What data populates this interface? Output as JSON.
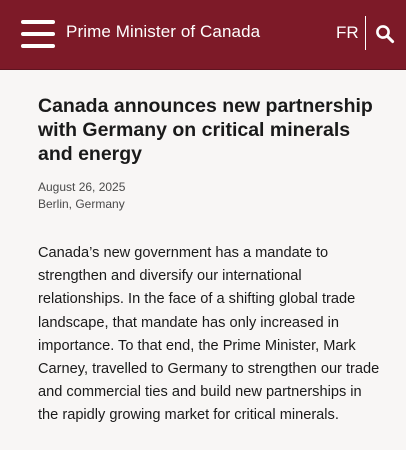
{
  "header": {
    "title": "Prime Minister of Canada",
    "lang_label": "FR",
    "menu_icon": "hamburger-menu-icon",
    "search_icon": "search-icon",
    "brand_color": "#7d1a28"
  },
  "article": {
    "title": "Canada announces new partnership with Germany on critical minerals and energy",
    "date": "August 26, 2025",
    "location": "Berlin, Germany",
    "body": "Canada’s new government has a mandate to strengthen and diversify our international relationships. In the face of a shifting global trade landscape, that mandate has only increased in importance. To that end, the Prime Minister, Mark Carney, travelled to Germany to strengthen our trade and commercial ties and build new partnerships in the rapidly growing market for critical minerals."
  }
}
